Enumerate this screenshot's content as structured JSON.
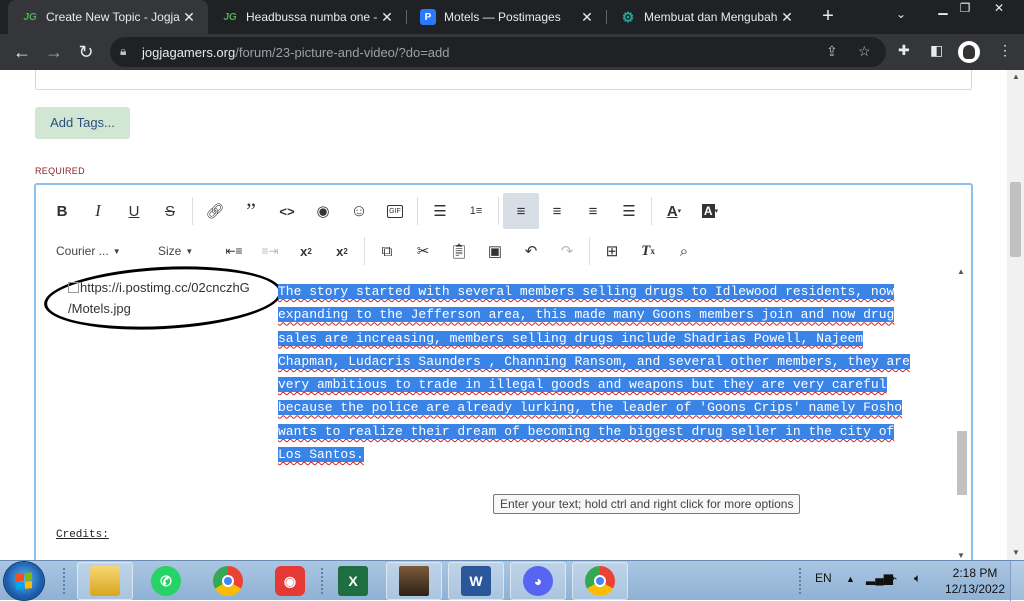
{
  "browser": {
    "tabs": [
      {
        "title": "Create New Topic - Jogjag",
        "favicon": "jg-icon",
        "fav_text": "JG",
        "fav_color": "#4caf50",
        "active": true
      },
      {
        "title": "Headbussa numba one - J",
        "favicon": "jg-icon",
        "fav_text": "JG",
        "fav_color": "#4caf50",
        "active": false
      },
      {
        "title": "Motels — Postimages",
        "favicon": "postimages-icon",
        "fav_text": "P",
        "fav_color": "#2979ff",
        "active": false
      },
      {
        "title": "Membuat dan Mengubah",
        "favicon": "gear-green-icon",
        "fav_text": "⚙",
        "fav_color": "#26a69a",
        "active": false
      }
    ],
    "new_tab": "+",
    "url_host": "jogjagamers.org",
    "url_path": "/forum/23-picture-and-video/?do=add"
  },
  "form": {
    "add_tags_label": "Add Tags...",
    "required_label": "REQUIRED"
  },
  "editor": {
    "font_label": "Courier ...",
    "size_label": "Size",
    "image_alt": "https://i.postimg.cc/02cnczhG/Motels.jpg",
    "image_alt_line1": "https://i.postimg.cc/02cnczhG",
    "image_alt_line2": "/Motels.jpg",
    "lines": [
      "The story started with several members selling drugs to Idlewood residents, now",
      "expanding to the Jefferson area, this made many Goons members join and now drug",
      "sales are increasing, members selling drugs include Shadrias Powell, Najeem",
      "Chapman, Ludacris Saunders , Channing Ransom, and several other members, they are",
      "very ambitious to trade in illegal goods and weapons but they are very careful",
      "because the police are already lurking, the leader of 'Goons Crips' namely Fosho",
      "wants to realize their dream of becoming the biggest drug seller in the city of",
      "Los Santos."
    ],
    "credits_label": "Credits:",
    "tooltip": "Enter your text; hold ctrl and right click for more options"
  },
  "taskbar": {
    "language": "EN",
    "time": "2:18 PM",
    "date": "12/13/2022"
  }
}
